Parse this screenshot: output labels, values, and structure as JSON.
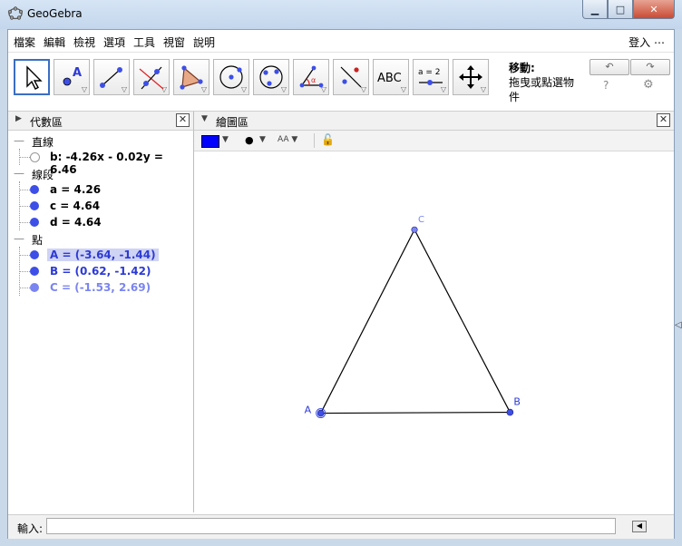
{
  "window": {
    "title": "GeoGebra",
    "minimize": "▁",
    "maximize": "□",
    "close": "✕"
  },
  "menu": {
    "items": [
      "檔案",
      "編輯",
      "檢視",
      "選項",
      "工具",
      "視窗",
      "說明"
    ],
    "login": "登入 ⋯"
  },
  "toolbar": {
    "tools": [
      "move-tool",
      "point-tool",
      "segment-tool",
      "perpendicular-line-tool",
      "polygon-tool",
      "circle-tool",
      "conic-tool",
      "angle-tool",
      "reflect-tool",
      "text-tool",
      "slider-tool",
      "move-graphics-tool"
    ],
    "text_tool_label": "ABC",
    "slider_tool_label": "a = 2",
    "help_title": "移動:",
    "help_text": "拖曳或點選物件",
    "undo": "↶",
    "redo": "↷",
    "help_icon": "?",
    "settings_icon": "⚙"
  },
  "algebra": {
    "title": "代數區",
    "categories": [
      {
        "label": "直線",
        "items": [
          {
            "text": "b: -4.26x - 0.02y = 6.46",
            "style": "hollow"
          }
        ]
      },
      {
        "label": "線段",
        "items": [
          {
            "text": "a = 4.26",
            "style": "filled"
          },
          {
            "text": "c = 4.64",
            "style": "filled"
          },
          {
            "text": "d = 4.64",
            "style": "filled"
          }
        ]
      },
      {
        "label": "點",
        "items": [
          {
            "text": "A = (-3.64, -1.44)",
            "style": "selected"
          },
          {
            "text": "B = (0.62, -1.42)",
            "style": "filled"
          },
          {
            "text": "C = (-1.53, 2.69)",
            "style": "light"
          }
        ]
      }
    ]
  },
  "graphics": {
    "title": "繪圖區",
    "line_color": "#0000ff",
    "points": [
      {
        "name": "A",
        "x": -3.64,
        "y": -1.44
      },
      {
        "name": "B",
        "x": 0.62,
        "y": -1.42
      },
      {
        "name": "C",
        "x": -1.53,
        "y": 2.69
      }
    ],
    "point_color": "#3d4fe6",
    "segment_color": "#000000"
  },
  "input": {
    "label": "輸入:",
    "value": "",
    "placeholder": ""
  },
  "colors": {
    "accent": "#3a6ec4",
    "point": "#3d4fe6",
    "selected_bg": "#cfd3f4"
  }
}
